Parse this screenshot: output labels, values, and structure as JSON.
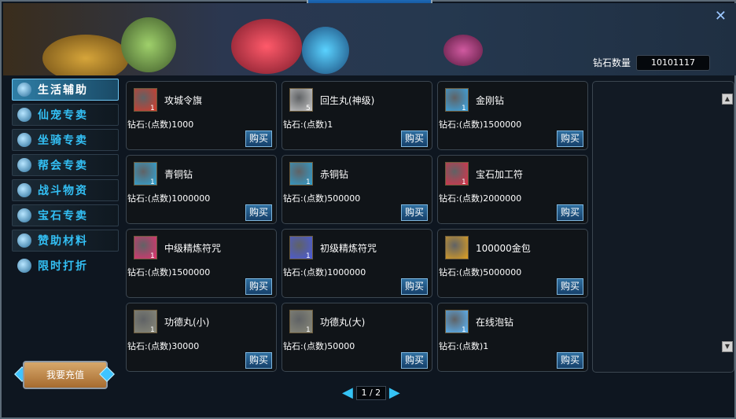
{
  "header": {
    "diamond_label": "钻石数量",
    "diamond_value": "10101117",
    "close_glyph": "✕"
  },
  "sidebar": {
    "items": [
      {
        "label": "生活辅助",
        "icon": "gear-icon",
        "active": true
      },
      {
        "label": "仙宠专卖",
        "icon": "paw-icon",
        "active": false
      },
      {
        "label": "坐骑专卖",
        "icon": "horse-icon",
        "active": false
      },
      {
        "label": "帮会专卖",
        "icon": "flag-icon",
        "active": false
      },
      {
        "label": "战斗物资",
        "icon": "box-icon",
        "active": false
      },
      {
        "label": "宝石专卖",
        "icon": "gem-icon",
        "active": false
      },
      {
        "label": "赞助材料",
        "icon": "mountain-icon",
        "active": false
      },
      {
        "label": "限时打折",
        "icon": "megaphone-icon",
        "active": false
      }
    ]
  },
  "recharge_label": "我要充值",
  "buy_label": "购买",
  "products": [
    {
      "name": "攻城令旗",
      "qty": "1",
      "price": "钻石:(点数)1000",
      "icon": "banner-flag-icon",
      "color": "#d83a2a"
    },
    {
      "name": "回生丸(神级)",
      "qty": "5",
      "price": "钻石:(点数)1",
      "icon": "pill-bowl-icon",
      "color": "#c9c9c9"
    },
    {
      "name": "金刚钻",
      "qty": "1",
      "price": "钻石:(点数)1500000",
      "icon": "blue-diamond-icon",
      "color": "#3aa8e8"
    },
    {
      "name": "青铜钻",
      "qty": "1",
      "price": "钻石:(点数)1000000",
      "icon": "bronze-diamond-icon",
      "color": "#2fa6d8"
    },
    {
      "name": "赤铜钻",
      "qty": "1",
      "price": "钻石:(点数)500000",
      "icon": "copper-diamond-icon",
      "color": "#2f9fcf"
    },
    {
      "name": "宝石加工符",
      "qty": "1",
      "price": "钻石:(点数)2000000",
      "icon": "scroll-red-icon",
      "color": "#e0304a"
    },
    {
      "name": "中级精炼符咒",
      "qty": "1",
      "price": "钻石:(点数)1500000",
      "icon": "scroll-pink-icon",
      "color": "#e63070"
    },
    {
      "name": "初级精炼符咒",
      "qty": "1",
      "price": "钻石:(点数)1000000",
      "icon": "scroll-blue-icon",
      "color": "#4a5ae0"
    },
    {
      "name": "100000金包",
      "qty": "",
      "price": "钻石:(点数)5000000",
      "icon": "gold-bag-icon",
      "color": "#e0a020"
    },
    {
      "name": "功德丸(小)",
      "qty": "1",
      "price": "钻石:(点数)30000",
      "icon": "pearl-icon",
      "color": "#8a8a7a"
    },
    {
      "name": "功德丸(大)",
      "qty": "1",
      "price": "钻石:(点数)50000",
      "icon": "pearl-icon",
      "color": "#8a8a7a"
    },
    {
      "name": "在线泡钻",
      "qty": "1",
      "price": "钻石:(点数)1",
      "icon": "crystal-diamond-icon",
      "color": "#5ab8ff"
    }
  ],
  "pager": {
    "text": "1 / 2"
  },
  "scroll": {
    "up": "▲",
    "down": "▼"
  },
  "colors": {
    "accent": "#33c0f5",
    "panel": "#101418",
    "buy": "#2f6fa0"
  }
}
